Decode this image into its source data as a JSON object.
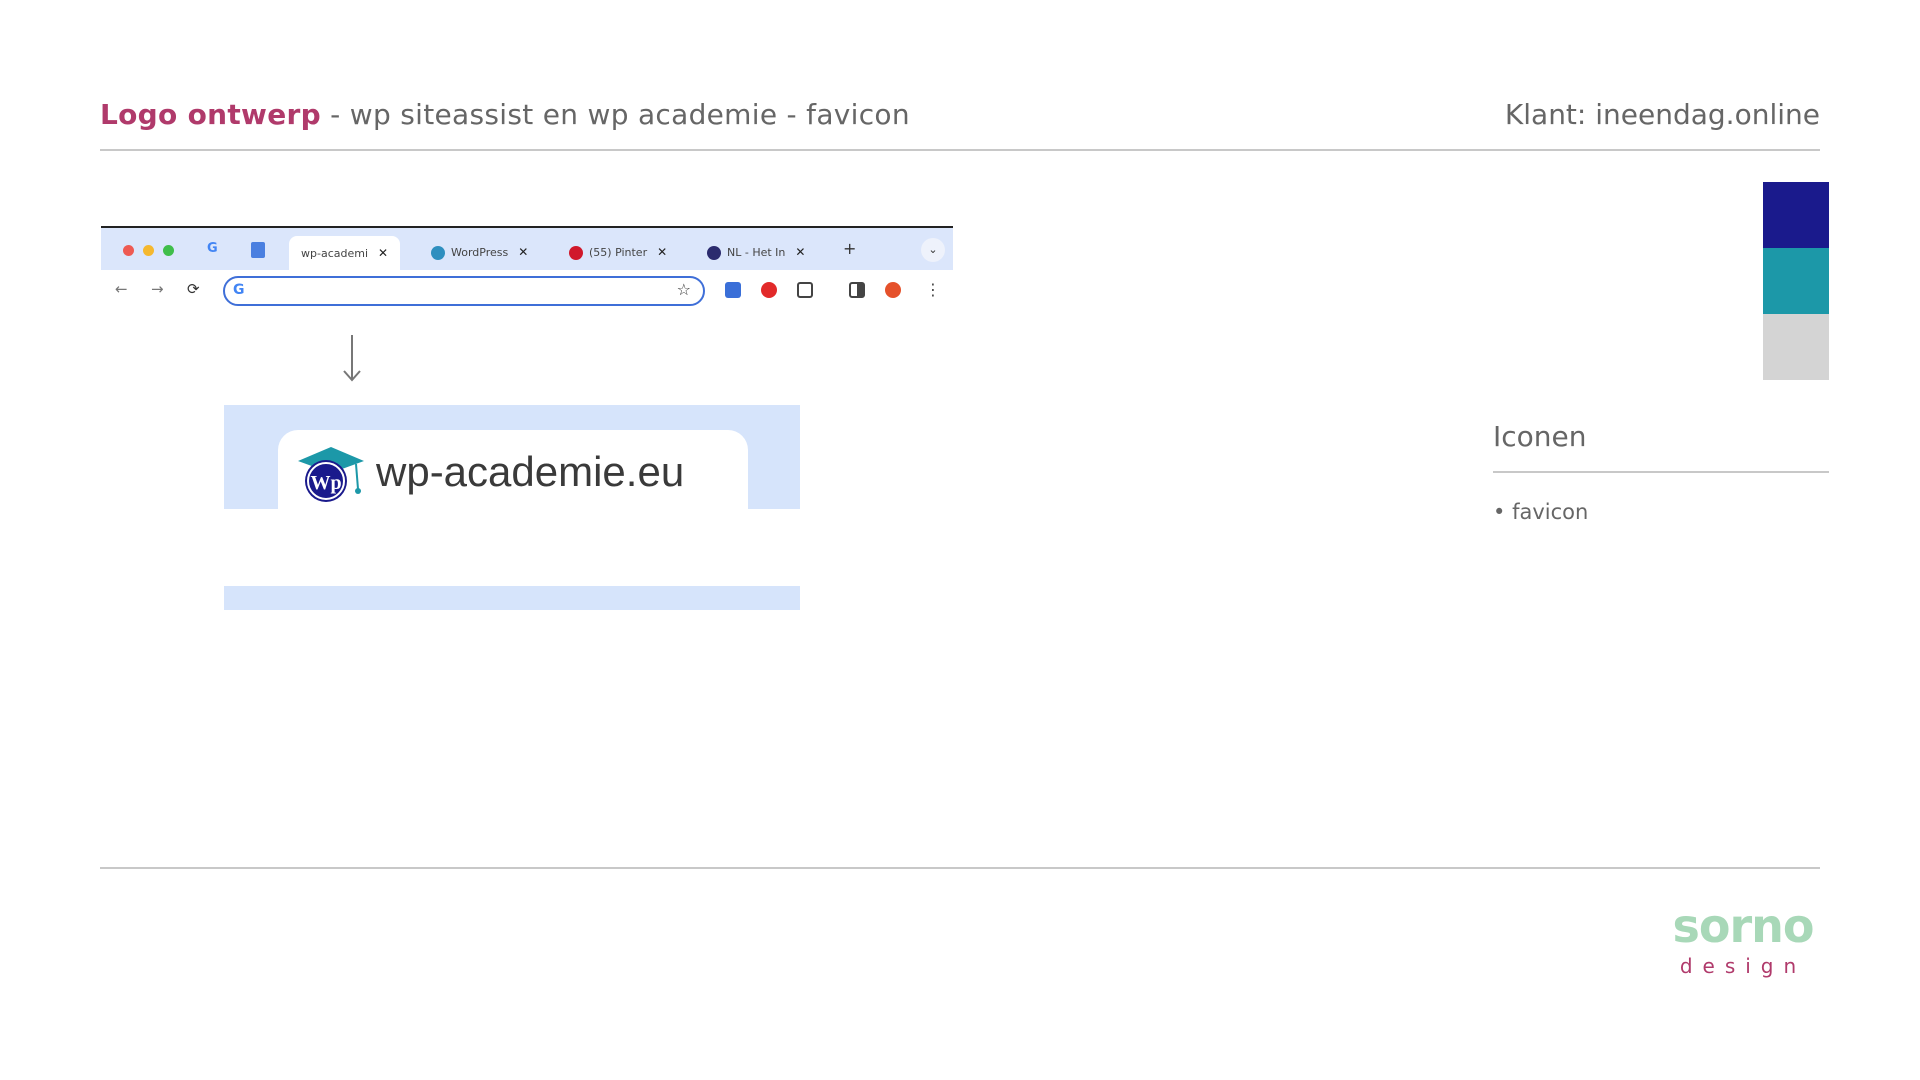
{
  "header": {
    "title_accent": "Logo ontwerp",
    "title_rest": " - wp siteassist en wp academie - favicon",
    "client": "Klant: ineendag.online"
  },
  "browser": {
    "tabs": [
      {
        "label": "wp-academi",
        "icon": "wp-academie-favicon",
        "active": true
      },
      {
        "label": "WordPress",
        "icon": "wordpress-icon"
      },
      {
        "label": "(55) Pinter",
        "icon": "pinterest-icon"
      },
      {
        "label": "NL - Het In",
        "icon": "site-icon"
      }
    ],
    "new_tab": "+",
    "nav": {
      "back": "←",
      "forward": "→",
      "reload": "⟳"
    },
    "star": "☆",
    "menu": "⋮"
  },
  "preview": {
    "domain_text": "wp-academie.eu",
    "logo_text": "Wp"
  },
  "colors": {
    "accent": "#b03a6b",
    "swatches": [
      "#1a1a8c",
      "#1c98a8",
      "#d4d4d4"
    ]
  },
  "sidebar": {
    "title": "Iconen",
    "items": [
      "favicon"
    ]
  },
  "footer": {
    "brand_name": "sorno",
    "brand_sub": "design"
  }
}
